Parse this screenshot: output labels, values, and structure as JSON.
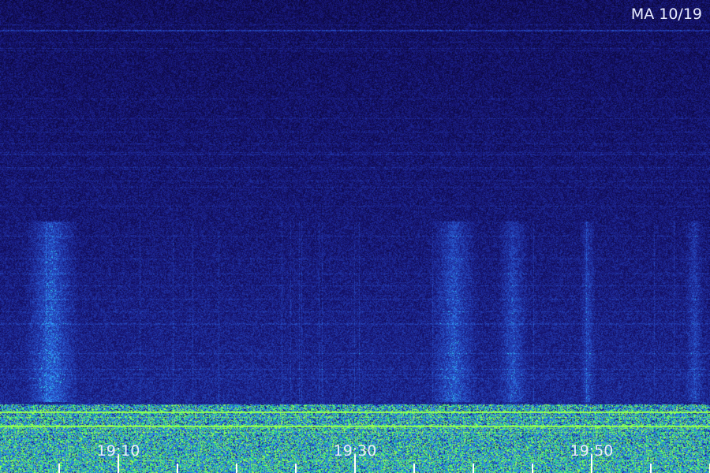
{
  "chart_data": {
    "type": "heatmap",
    "title": "MA 10/19",
    "x_tick_labels": [
      "19:10",
      "19:30",
      "19:50"
    ],
    "x_tick_count": 12,
    "labeled_every": 4,
    "first_labeled_index": 1,
    "grid": false,
    "colors": {
      "background": "#0a0838",
      "low": "#1a1a8a",
      "mid": "#2a5cff",
      "high": "#22d48f",
      "peak": "#a8ff4a",
      "text": "#e8ecff",
      "tick": "#ffffff"
    }
  }
}
